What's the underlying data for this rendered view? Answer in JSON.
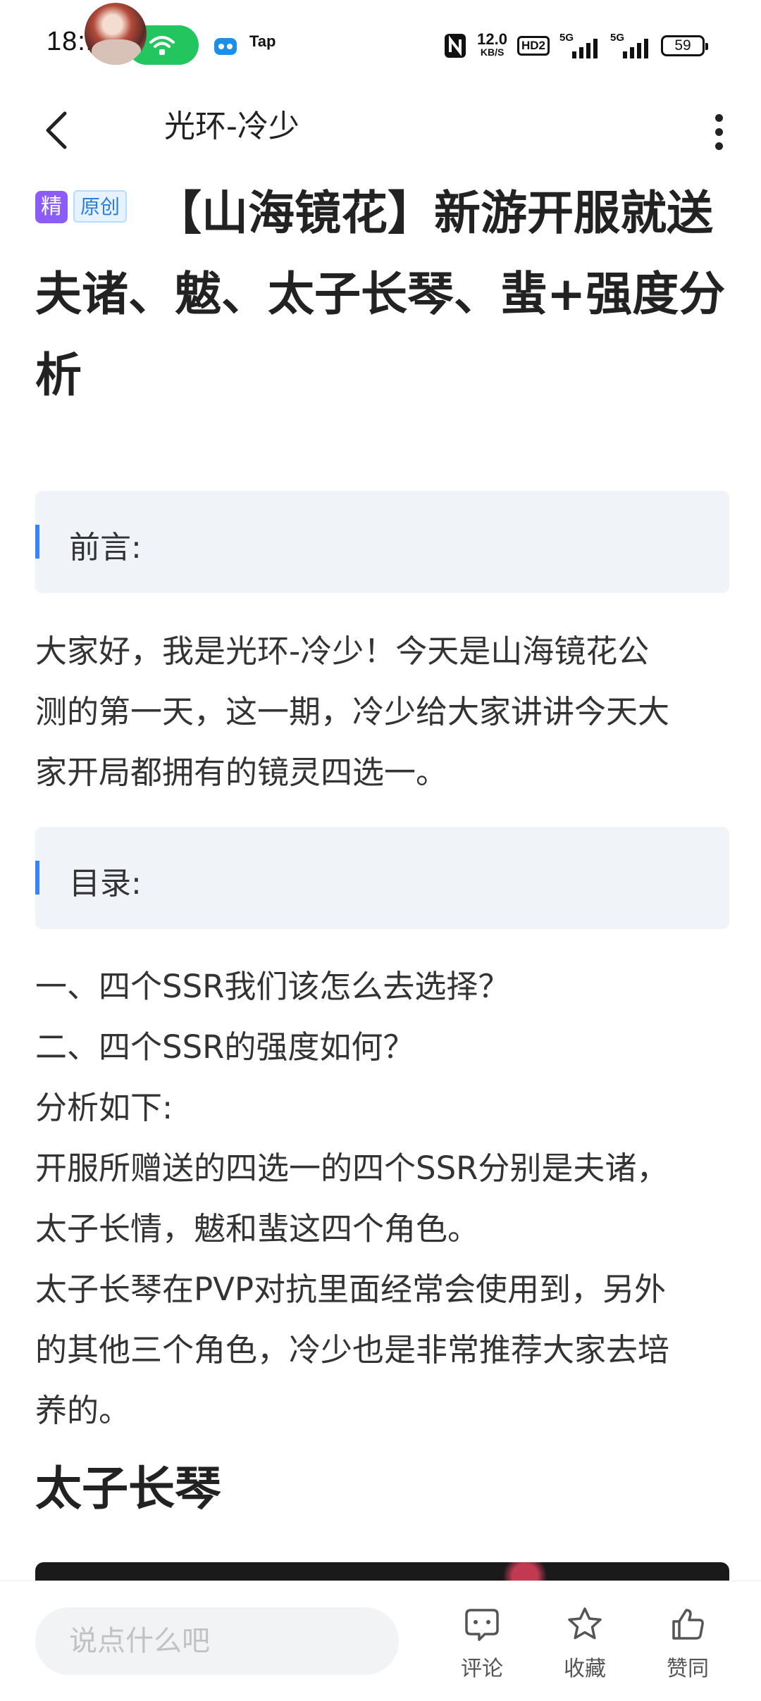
{
  "status_bar": {
    "time": "18:13",
    "app_label": "Tap",
    "net_speed_value": "12.0",
    "net_speed_unit": "KB/S",
    "hd_label": "HD2",
    "signal1_label": "5G",
    "signal2_label": "5G",
    "battery": "59"
  },
  "header": {
    "author_name": "光环-冷少"
  },
  "article": {
    "badge_featured": "精",
    "badge_original": "原创",
    "title": "【山海镜花】新游开服就送夫诸、魃、太子长琴、蜚+强度分析",
    "sections": {
      "preface_label": "前言:",
      "toc_label": "目录:"
    },
    "intro_lines": [
      "大家好，我是光环-冷少！今天是山海镜花公",
      "测的第一天，这一期，冷少给大家讲讲今天大",
      "家开局都拥有的镜灵四选一。"
    ],
    "body_lines": [
      "一、四个SSR我们该怎么去选择？",
      "二、四个SSR的强度如何？",
      "分析如下:",
      "开服所赠送的四选一的四个SSR分别是夫诸，",
      "太子长情，魃和蜚这四个角色。",
      "太子长琴在PVP对抗里面经常会使用到，另外",
      "的其他三个角色，冷少也是非常推荐大家去培",
      "养的。"
    ],
    "sub_heading": "太子长琴"
  },
  "bottom_bar": {
    "comment_placeholder": "说点什么吧",
    "comment_label": "评论",
    "favorite_label": "收藏",
    "like_label": "赞同"
  },
  "colors": {
    "accent_blue": "#3b82f6",
    "featured_purple": "#8b5cf6",
    "hotspot_green": "#22c55e",
    "section_bg": "#f0f3f7"
  }
}
